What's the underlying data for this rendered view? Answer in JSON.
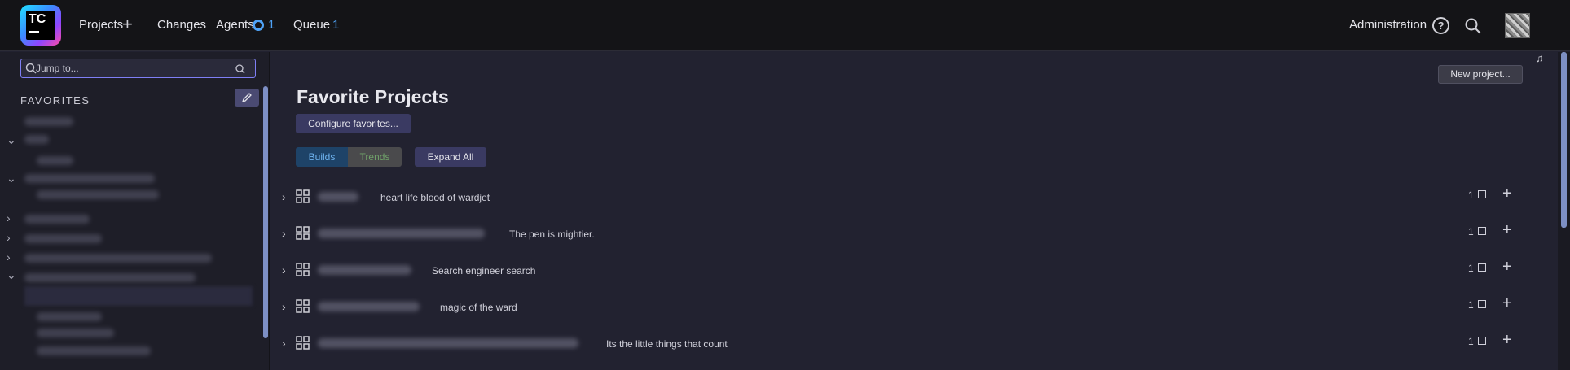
{
  "header": {
    "logo_text": "TC",
    "nav": {
      "projects": "Projects",
      "changes": "Changes",
      "agents": "Agents",
      "agents_count": "1",
      "queue": "Queue",
      "queue_count": "1"
    },
    "administration": "Administration"
  },
  "sidebar": {
    "search_placeholder": "Jump to...",
    "favorites_title": "FAVORITES"
  },
  "main": {
    "new_project_label": "New project...",
    "title": "Favorite Projects",
    "configure_label": "Configure favorites...",
    "tabs": {
      "builds": "Builds",
      "trends": "Trends"
    },
    "expand_all_label": "Expand All",
    "projects": [
      {
        "description": "heart life blood of wardjet",
        "count": "1"
      },
      {
        "description": "The pen is mightier.",
        "count": "1"
      },
      {
        "description": "Search engineer search",
        "count": "1"
      },
      {
        "description": "magic of the ward",
        "count": "1"
      },
      {
        "description": "Its the little things that count",
        "count": "1"
      }
    ]
  },
  "colors": {
    "accent": "#4fa3f7",
    "header_bg": "#141417",
    "main_bg": "#222230",
    "button_bg": "#3a3a62"
  }
}
